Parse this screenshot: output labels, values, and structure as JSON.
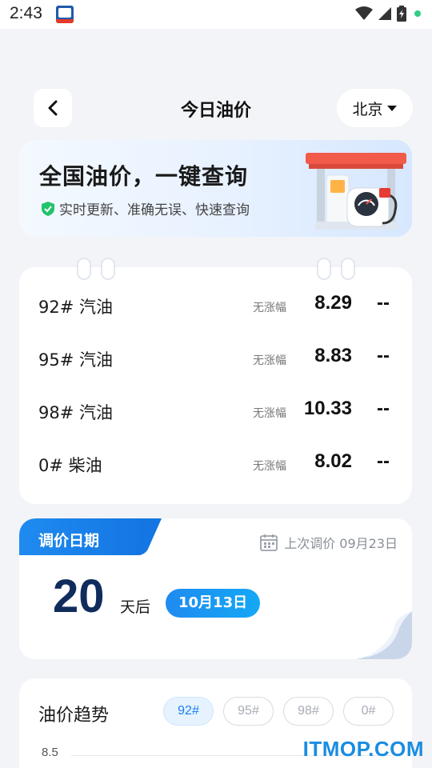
{
  "status_bar": {
    "time": "2:43"
  },
  "header": {
    "title": "今日油价",
    "city": "北京"
  },
  "banner": {
    "title": "全国油价，一键查询",
    "subtitle": "实时更新、准确无误、快速查询"
  },
  "prices": [
    {
      "name": "92# 汽油",
      "change": "无涨幅",
      "price": "8.29",
      "trend": "--"
    },
    {
      "name": "95# 汽油",
      "change": "无涨幅",
      "price": "8.83",
      "trend": "--"
    },
    {
      "name": "98# 汽油",
      "change": "无涨幅",
      "price": "10.33",
      "trend": "--"
    },
    {
      "name": "0# 柴油",
      "change": "无涨幅",
      "price": "8.02",
      "trend": "--"
    }
  ],
  "adjust": {
    "tab_label": "调价日期",
    "last_adjust": "上次调价 09月23日",
    "days": "20",
    "days_suffix": "天后",
    "next_date": "10月13日"
  },
  "trend": {
    "title": "油价趋势",
    "tabs": [
      "92#",
      "95#",
      "98#",
      "0#"
    ],
    "active_tab": "92#",
    "y_label": "8.5"
  },
  "watermark": "ITMOP.COM",
  "colors": {
    "accent": "#1a7ef0",
    "dark_number": "#0f2c5c",
    "status_dot": "#2fce82"
  }
}
